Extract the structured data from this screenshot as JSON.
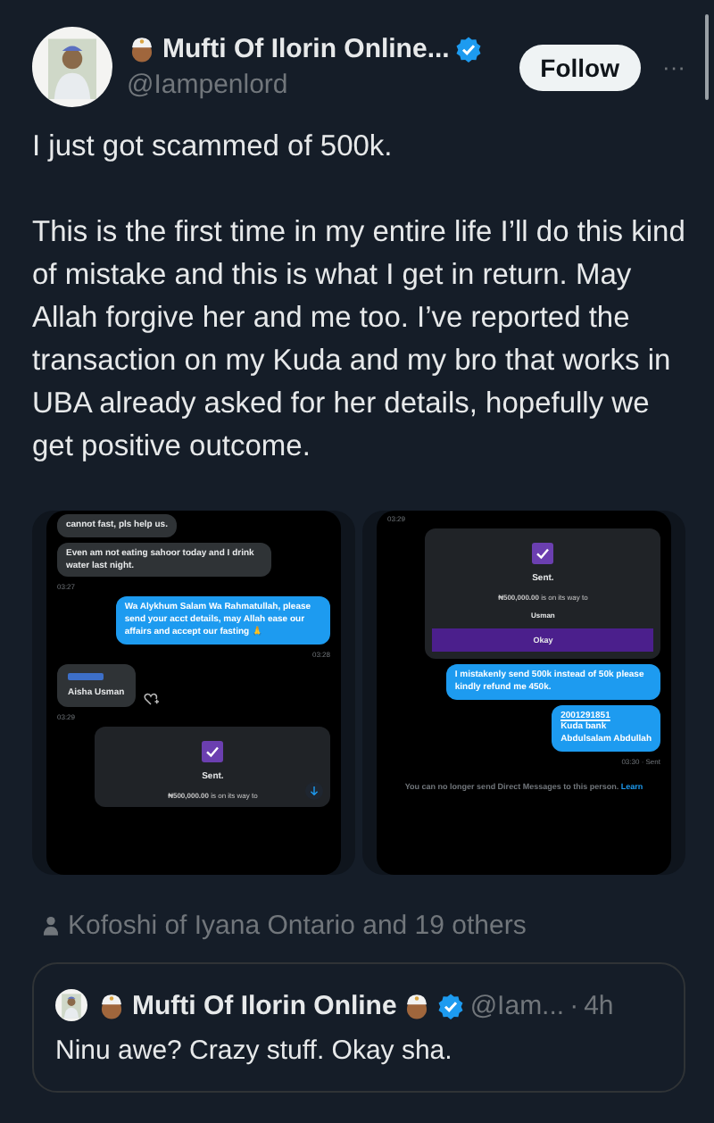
{
  "author": {
    "name": "Mufti Of Ilorin Online...",
    "handle": "@Iampenlord",
    "verified": true
  },
  "follow_button": "Follow",
  "more_button": "···",
  "tweet_text": [
    "I just got scammed of 500k.",
    "This is the first time in my entire life I’ll do this kind of mistake and this is what I get in return. May Allah forgive her and me too. I’ve reported the transaction on my Kuda and my bro that works in UBA already asked for her details, hopefully we get positive outcome."
  ],
  "media": [
    {
      "messages": [
        {
          "kind": "received",
          "text": "cannot fast, pls help us."
        },
        {
          "kind": "received",
          "text": "Even am not eating sahoor today and I drink water last night."
        },
        {
          "kind": "time_in",
          "text": "03:27"
        },
        {
          "kind": "sent",
          "lines": [
            "Wa Alykhum Salam Wa Rahmatullah, please send your acct details, may Allah ease our affairs and accept our fasting 🙏"
          ]
        },
        {
          "kind": "time_out",
          "text": "03:28"
        },
        {
          "kind": "contact",
          "text": "Aisha Usman"
        },
        {
          "kind": "time_in",
          "text": "03:29"
        },
        {
          "kind": "card",
          "title": "Sent.",
          "amount": "₦500,000.00",
          "note": "is on its way to"
        }
      ]
    },
    {
      "messages": [
        {
          "kind": "time_in",
          "text": "03:29"
        },
        {
          "kind": "card",
          "title": "Sent.",
          "amount": "₦500,000.00",
          "note": "is on its way to",
          "recipient": "Usman",
          "button": "Okay"
        },
        {
          "kind": "sent",
          "lines": [
            "I mistakenly send 500k instead of 50k please kindly refund me 450k."
          ]
        },
        {
          "kind": "sent",
          "lines": [
            "2001291851",
            "Kuda bank",
            "Abdulsalam Abdullah"
          ]
        },
        {
          "kind": "time_out",
          "text": "03:30 · Sent"
        },
        {
          "kind": "notice",
          "text": "You can no longer send Direct Messages to this person.",
          "link": "Learn"
        }
      ]
    }
  ],
  "social_context": "Kofoshi of Iyana Ontario and 19 others",
  "quote": {
    "name": "Mufti Of Ilorin Online",
    "verified": true,
    "handle": "@Iam...",
    "separator": "·",
    "time": "4h",
    "text": "Ninu awe? Crazy stuff. Okay sha."
  }
}
